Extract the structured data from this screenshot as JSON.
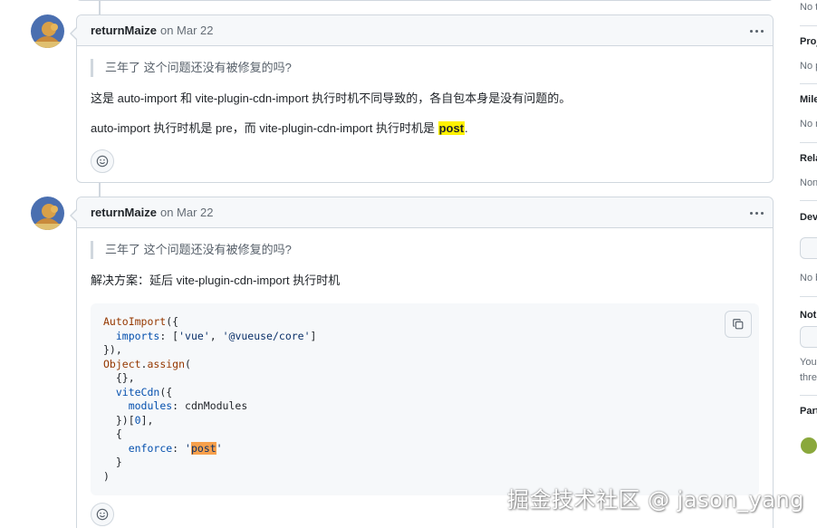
{
  "comments": [
    {
      "author": "returnMaize",
      "date": "on Mar 22",
      "quote": "三年了 这个问题还没有被修复的吗?",
      "para1": "这是 auto-import 和 vite-plugin-cdn-import 执行时机不同导致的，各自包本身是没有问题的。",
      "para2_prefix": "auto-import 执行时机是 pre，而 vite-plugin-cdn-import 执行时机是 ",
      "para2_highlight": "post",
      "para2_suffix": "."
    },
    {
      "author": "returnMaize",
      "date": "on Mar 22",
      "quote": "三年了 这个问题还没有被修复的吗?",
      "para1": "解决方案：延后 vite-plugin-cdn-import 执行时机",
      "code": {
        "l1_fn": "AutoImport",
        "l1_rest": "({",
        "l2_prop": "imports",
        "l2_rest_a": ": [",
        "l2_s1": "'vue'",
        "l2_sep": ", ",
        "l2_s2": "'@vueuse/core'",
        "l2_rest_b": "]",
        "l3": "}),",
        "l4_fn": "Object",
        "l4_dot": ".",
        "l4_method": "assign",
        "l4_rest": "(",
        "l5": "{},",
        "l6_prop": "viteCdn",
        "l6_rest": "({",
        "l7_prop": "modules",
        "l7_rest": ": cdnModules",
        "l8_a": "})[",
        "l8_num": "0",
        "l8_b": "],",
        "l9": "{",
        "l10_prop": "enforce",
        "l10_rest": ": ",
        "l10_q1": "'",
        "l10_val": "post",
        "l10_q2": "'",
        "l11": "}",
        "l12": ")"
      }
    }
  ],
  "sidebar": {
    "s0": "No t",
    "s1_head": "Proj",
    "s1_val": "No p",
    "s2_head": "Mile",
    "s2_val": "No n",
    "s3_head": "Rela",
    "s3_val": "Non",
    "s4_head": "Dev",
    "s4_val": "No b",
    "s5_head": "Noti",
    "s5_val1": "You",
    "s5_val2": "thre",
    "s6_head": "Part"
  },
  "watermark": "掘金技术社区 @ jason_yang",
  "icons": {
    "kebab": "kebab-horizontal-icon",
    "reaction": "smiley-icon",
    "copy": "copy-icon"
  }
}
